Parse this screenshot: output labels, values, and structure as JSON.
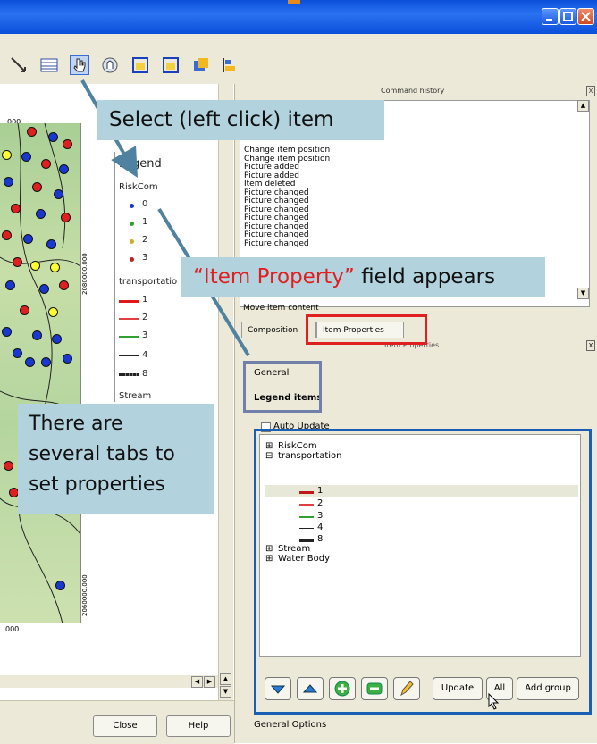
{
  "colors": {
    "titlebar": "#1b5be0",
    "callout_bg": "#b2d3de",
    "highlight_red": "#e02020",
    "highlight_blue": "#1a5fb4",
    "highlight_gray": "#7080a8"
  },
  "window_controls": {
    "minimize_icon": "minimize-icon",
    "maximize_icon": "maximize-icon",
    "close_icon": "close-icon"
  },
  "toolbar": {
    "icons": [
      "line-tool-icon",
      "table-icon",
      "select-item-icon",
      "move-content-icon",
      "group-icon",
      "ungroup-icon",
      "raise-icon",
      "align-icon"
    ]
  },
  "map": {
    "axis_top": "000",
    "axis_bottom": "000",
    "side_ticks": [
      "2080000.000",
      "2060000.000"
    ],
    "legend": {
      "title": "Legend",
      "layer": "RiskCom",
      "riskcom_items": [
        "0",
        "1",
        "2",
        "3"
      ],
      "transport_label": "transportatio",
      "transport_items": [
        "1",
        "2",
        "3",
        "4",
        "8"
      ],
      "stream_label": "Stream"
    }
  },
  "bottom_buttons": {
    "close": "Close",
    "help": "Help"
  },
  "command_history": {
    "header": "Command history",
    "items": [
      "Change item position",
      "Change item position",
      "Picture added",
      "Picture added",
      "Item deleted",
      "Picture changed",
      "Picture changed",
      "Picture changed",
      "Picture changed",
      "Picture changed",
      "Picture changed",
      "Picture changed"
    ],
    "more": "Move item content"
  },
  "tabs": {
    "composition": "Composition",
    "item_properties": "Item Properties"
  },
  "item_properties_title": "Item Properties",
  "sections": {
    "general": "General",
    "legend_items": "Legend items",
    "general_options": "General Options"
  },
  "legend_panel": {
    "auto_update": "Auto Update",
    "tree": [
      {
        "label": "RiskCom",
        "kind": "group"
      },
      {
        "label": "transportation",
        "kind": "group-open"
      },
      {
        "label": "1",
        "kind": "item"
      },
      {
        "label": "2",
        "kind": "item"
      },
      {
        "label": "3",
        "kind": "item"
      },
      {
        "label": "4",
        "kind": "item"
      },
      {
        "label": "8",
        "kind": "item"
      },
      {
        "label": "Stream",
        "kind": "group"
      },
      {
        "label": "Water Body",
        "kind": "group"
      }
    ],
    "buttons": {
      "update": "Update",
      "all": "All",
      "add_group": "Add group"
    }
  },
  "callouts": {
    "select": "Select (left click) item",
    "item_prop_quoted": "“Item Property”",
    "item_prop_rest": " field appears",
    "tabs_line1": "There are",
    "tabs_line2": "several tabs to",
    "tabs_line3": "set properties"
  }
}
